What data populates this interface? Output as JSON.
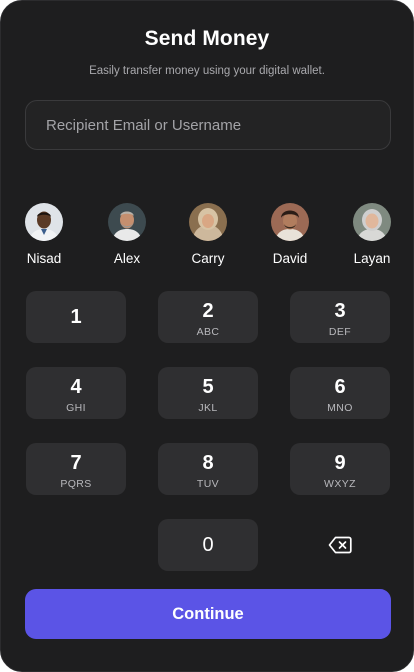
{
  "header": {
    "title": "Send Money",
    "subtitle": "Easily transfer money using your digital wallet."
  },
  "recipient": {
    "value": "",
    "placeholder": "Recipient Email or Username"
  },
  "contacts": [
    {
      "name": "Nisad",
      "avatar": "avatar-icon"
    },
    {
      "name": "Alex",
      "avatar": "avatar-icon"
    },
    {
      "name": "Carry",
      "avatar": "avatar-icon"
    },
    {
      "name": "David",
      "avatar": "avatar-icon"
    },
    {
      "name": "Layan",
      "avatar": "avatar-icon"
    }
  ],
  "keypad": [
    {
      "digit": "1",
      "letters": ""
    },
    {
      "digit": "2",
      "letters": "ABC"
    },
    {
      "digit": "3",
      "letters": "DEF"
    },
    {
      "digit": "4",
      "letters": "GHI"
    },
    {
      "digit": "5",
      "letters": "JKL"
    },
    {
      "digit": "6",
      "letters": "MNO"
    },
    {
      "digit": "7",
      "letters": "PQRS"
    },
    {
      "digit": "8",
      "letters": "TUV"
    },
    {
      "digit": "9",
      "letters": "WXYZ"
    },
    {
      "digit": "0",
      "letters": ""
    }
  ],
  "backspace": {
    "icon": "backspace-icon"
  },
  "actions": {
    "continue_label": "Continue"
  },
  "colors": {
    "background": "#1e1e1f",
    "key": "#2f2f31",
    "accent": "#5b54e6",
    "muted_text": "#a9a9ad"
  }
}
